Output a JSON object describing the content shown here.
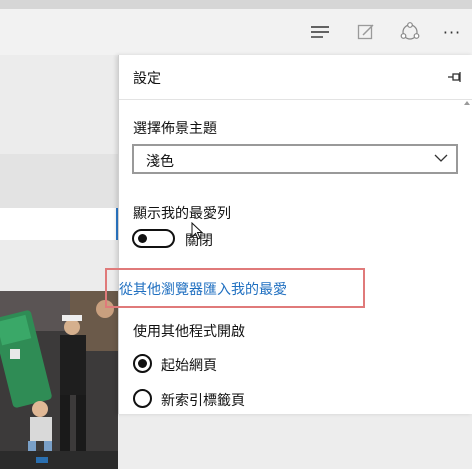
{
  "toolbar": {
    "icons": [
      "hub-icon",
      "web-note-icon",
      "share-icon",
      "more-icon"
    ],
    "more_label": "···"
  },
  "settings": {
    "title": "設定",
    "theme": {
      "label": "選擇佈景主題",
      "value": "淺色"
    },
    "favorites_bar": {
      "label": "顯示我的最愛列",
      "toggle_state": "關閉",
      "on": false
    },
    "import_link": "從其他瀏覽器匯入我的最愛",
    "open_with": {
      "label": "使用其他程式開啟",
      "options": [
        {
          "label": "起始網頁",
          "selected": true
        },
        {
          "label": "新索引標籤頁",
          "selected": false
        }
      ]
    }
  },
  "colors": {
    "accent": "#2b78c8",
    "link": "#1f6fc0",
    "highlight_border": "#e07a7a"
  }
}
